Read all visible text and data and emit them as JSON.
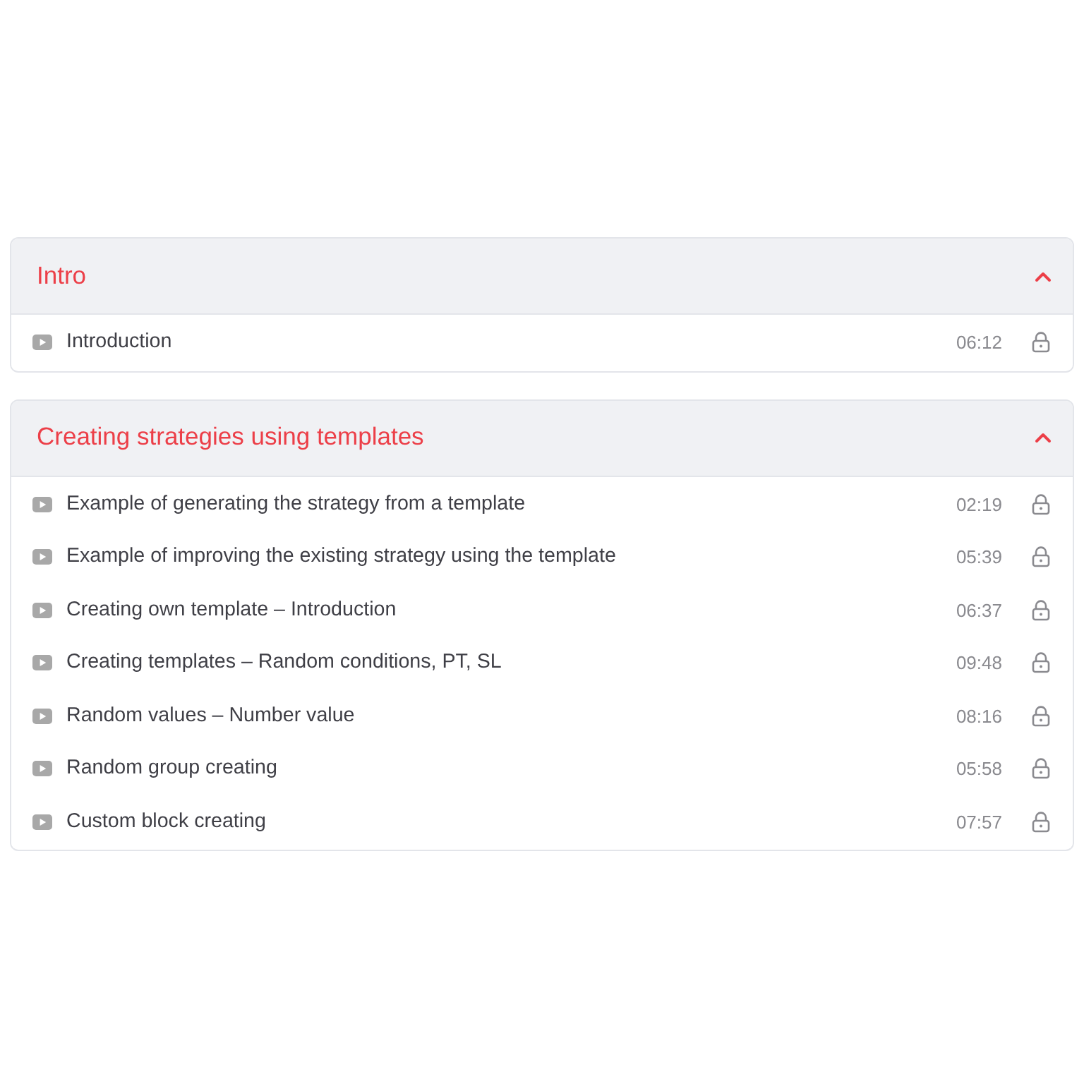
{
  "sections": [
    {
      "title": "Intro",
      "expanded": true,
      "lessons": [
        {
          "title": "Introduction",
          "duration": "06:12",
          "locked": true
        }
      ]
    },
    {
      "title": "Creating strategies using templates",
      "expanded": true,
      "lessons": [
        {
          "title": "Example of generating the strategy from a template",
          "duration": "02:19",
          "locked": true
        },
        {
          "title": "Example of improving the existing strategy using the template",
          "duration": "05:39",
          "locked": true
        },
        {
          "title": "Creating own template – Introduction",
          "duration": "06:37",
          "locked": true
        },
        {
          "title": "Creating templates – Random conditions, PT, SL",
          "duration": "09:48",
          "locked": true
        },
        {
          "title": "Random values – Number value",
          "duration": "08:16",
          "locked": true
        },
        {
          "title": "Random group creating",
          "duration": "05:58",
          "locked": true
        },
        {
          "title": "Custom block creating",
          "duration": "07:57",
          "locked": true
        }
      ]
    }
  ]
}
